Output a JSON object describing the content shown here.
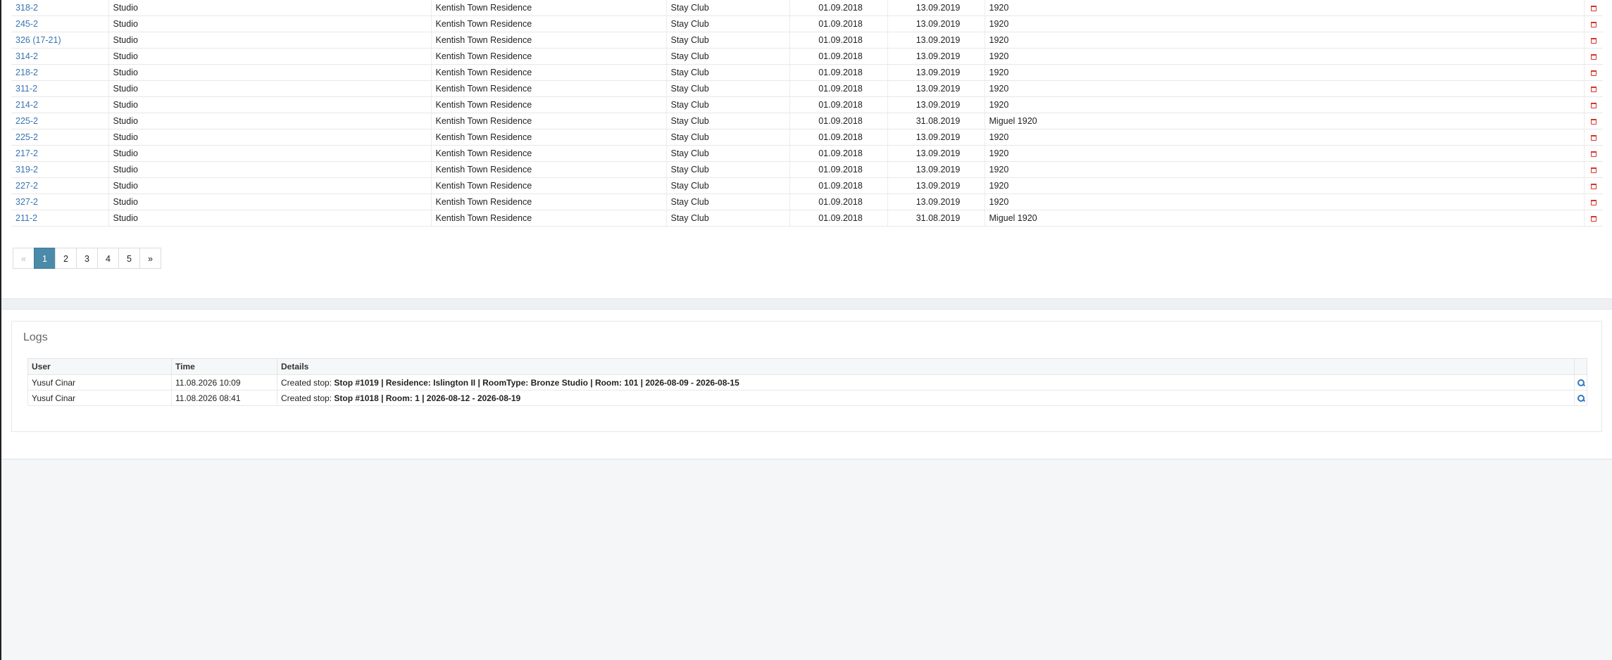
{
  "rooms": [
    {
      "room": "318-2",
      "type": "Studio",
      "residence": "Kentish Town Residence",
      "provider": "Stay Club",
      "start": "01.09.2018",
      "end": "13.09.2019",
      "note": "1920"
    },
    {
      "room": "245-2",
      "type": "Studio",
      "residence": "Kentish Town Residence",
      "provider": "Stay Club",
      "start": "01.09.2018",
      "end": "13.09.2019",
      "note": "1920"
    },
    {
      "room": "326 (17-21)",
      "type": "Studio",
      "residence": "Kentish Town Residence",
      "provider": "Stay Club",
      "start": "01.09.2018",
      "end": "13.09.2019",
      "note": "1920"
    },
    {
      "room": "314-2",
      "type": "Studio",
      "residence": "Kentish Town Residence",
      "provider": "Stay Club",
      "start": "01.09.2018",
      "end": "13.09.2019",
      "note": "1920"
    },
    {
      "room": "218-2",
      "type": "Studio",
      "residence": "Kentish Town Residence",
      "provider": "Stay Club",
      "start": "01.09.2018",
      "end": "13.09.2019",
      "note": "1920"
    },
    {
      "room": "311-2",
      "type": "Studio",
      "residence": "Kentish Town Residence",
      "provider": "Stay Club",
      "start": "01.09.2018",
      "end": "13.09.2019",
      "note": "1920"
    },
    {
      "room": "214-2",
      "type": "Studio",
      "residence": "Kentish Town Residence",
      "provider": "Stay Club",
      "start": "01.09.2018",
      "end": "13.09.2019",
      "note": "1920"
    },
    {
      "room": "225-2",
      "type": "Studio",
      "residence": "Kentish Town Residence",
      "provider": "Stay Club",
      "start": "01.09.2018",
      "end": "31.08.2019",
      "note": "Miguel 1920"
    },
    {
      "room": "225-2",
      "type": "Studio",
      "residence": "Kentish Town Residence",
      "provider": "Stay Club",
      "start": "01.09.2018",
      "end": "13.09.2019",
      "note": "1920"
    },
    {
      "room": "217-2",
      "type": "Studio",
      "residence": "Kentish Town Residence",
      "provider": "Stay Club",
      "start": "01.09.2018",
      "end": "13.09.2019",
      "note": "1920"
    },
    {
      "room": "319-2",
      "type": "Studio",
      "residence": "Kentish Town Residence",
      "provider": "Stay Club",
      "start": "01.09.2018",
      "end": "13.09.2019",
      "note": "1920"
    },
    {
      "room": "227-2",
      "type": "Studio",
      "residence": "Kentish Town Residence",
      "provider": "Stay Club",
      "start": "01.09.2018",
      "end": "13.09.2019",
      "note": "1920"
    },
    {
      "room": "327-2",
      "type": "Studio",
      "residence": "Kentish Town Residence",
      "provider": "Stay Club",
      "start": "01.09.2018",
      "end": "13.09.2019",
      "note": "1920"
    },
    {
      "room": "211-2",
      "type": "Studio",
      "residence": "Kentish Town Residence",
      "provider": "Stay Club",
      "start": "01.09.2018",
      "end": "31.08.2019",
      "note": "Miguel 1920"
    }
  ],
  "row_action_icon": "trash-icon",
  "pagination": {
    "prev": "«",
    "pages": [
      "1",
      "2",
      "3",
      "4",
      "5"
    ],
    "active": "1",
    "next": "»"
  },
  "logs": {
    "title": "Logs",
    "columns": {
      "user": "User",
      "time": "Time",
      "details": "Details"
    },
    "row_action_icon": "search-icon",
    "rows": [
      {
        "user": "Yusuf Cinar",
        "time": "11.08.2026 10:09",
        "prefix": "Created stop: ",
        "detail": "Stop #1019 | Residence: Islington II | RoomType: Bronze Studio | Room: 101 | 2026-08-09 - 2026-08-15"
      },
      {
        "user": "Yusuf Cinar",
        "time": "11.08.2026 08:41",
        "prefix": "Created stop: ",
        "detail": "Stop #1018 | Room: 1 | 2026-08-12 - 2026-08-19"
      }
    ]
  },
  "colors": {
    "link": "#3a73b3",
    "delete": "#d9312b",
    "pagination_active": "#4a8ba9",
    "view_icon": "#2f78c4"
  }
}
